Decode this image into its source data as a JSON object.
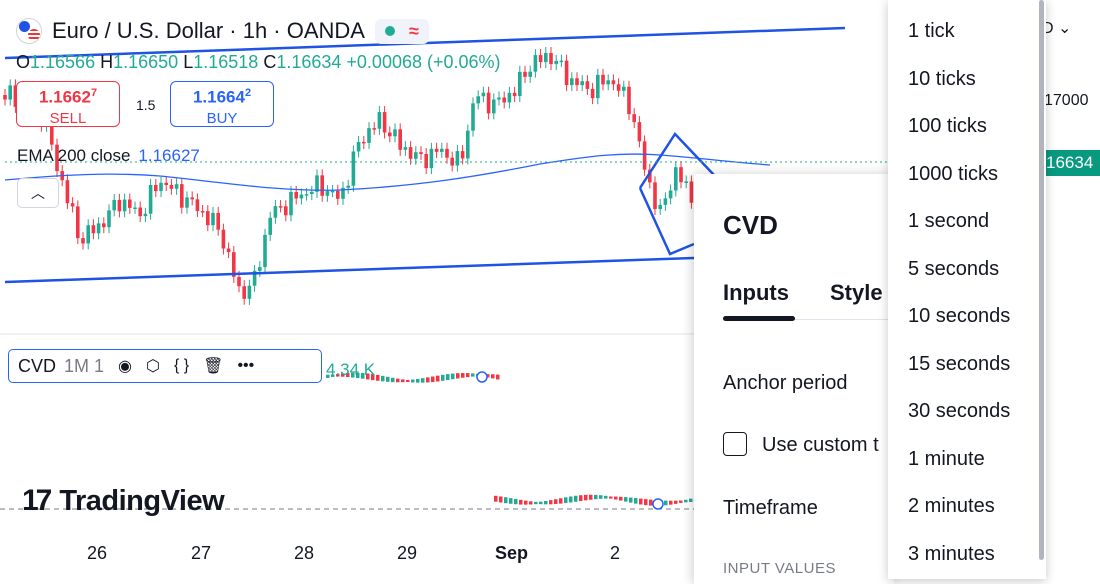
{
  "header": {
    "symbol_title": "Euro / U.S. Dollar · 1h · OANDA",
    "status_icon": "wave-icon"
  },
  "ohlc": {
    "o_label": "O",
    "o_value": "1.16566",
    "h_label": "H",
    "h_value": "1.16650",
    "l_label": "L",
    "l_value": "1.16518",
    "c_label": "C",
    "c_value": "1.16634",
    "change": "+0.00068 (+0.06%)"
  },
  "trade": {
    "sell_price_main": "1.1662",
    "sell_price_sup": "7",
    "sell_label": "SELL",
    "spread": "1.5",
    "buy_price_main": "1.1664",
    "buy_price_sup": "2",
    "buy_label": "BUY"
  },
  "ema": {
    "label": "EMA 200 close",
    "value": "1.16627"
  },
  "cvd_indicator": {
    "name": "CVD",
    "params": "1M 1",
    "value": "4.34 K"
  },
  "brand": {
    "name": "TradingView",
    "mark": "17"
  },
  "x_axis": [
    "26",
    "27",
    "28",
    "29",
    "Sep",
    "2"
  ],
  "price_axis": {
    "top_value": "17000",
    "last_price": "16634",
    "ctrl": "D"
  },
  "dialog": {
    "title": "CVD",
    "tabs": [
      "Inputs",
      "Style"
    ],
    "anchor_period_label": "Anchor period",
    "use_custom_label": "Use custom t",
    "timeframe_label": "Timeframe",
    "section_label": "INPUT VALUES"
  },
  "dropdown_options": [
    "1 tick",
    "10 ticks",
    "100 ticks",
    "1000 ticks",
    "1 second",
    "5 seconds",
    "10 seconds",
    "15 seconds",
    "30 seconds",
    "1 minute",
    "2 minutes",
    "3 minutes"
  ],
  "colors": {
    "up": "#22ab94",
    "down": "#f23645",
    "line": "#1e53e5",
    "ema": "#2962ff"
  }
}
